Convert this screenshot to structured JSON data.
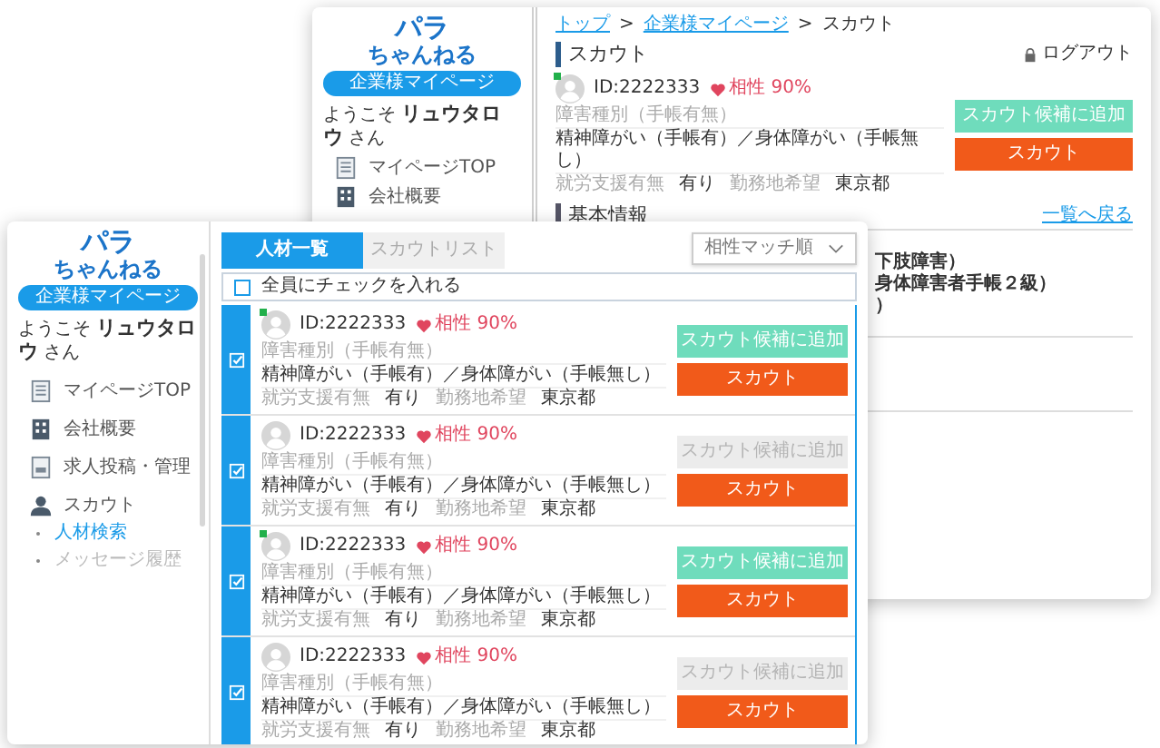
{
  "back_window": {
    "sidebar": {
      "logo": [
        "パラ",
        "ちゃんねる"
      ],
      "mypage_button": "企業様マイページ",
      "welcome": {
        "prefix": "ようこそ",
        "name": "リュウタロウ",
        "suffix": "さん"
      },
      "menu": [
        {
          "label": "マイページTOP",
          "kind": "document"
        },
        {
          "label": "会社概要",
          "kind": "building"
        }
      ]
    },
    "breadcrumb": [
      {
        "label": "トップ",
        "link": true
      },
      {
        "separator": ">",
        "label": "企業様マイページ",
        "link": true
      },
      {
        "separator": ">",
        "label": "スカウト",
        "link": false
      }
    ],
    "title": "スカウト",
    "logout": "ログアウト",
    "profile": {
      "online": true,
      "id": "ID:2222333",
      "match": "相性 90%",
      "disability_label": "障害種別（手帳有無）",
      "disability_value": "精神障がい（手帳有）／身体障がい（手帳無し）",
      "support_label": "就労支援有無",
      "support_value": "有り",
      "location_label": "勤務地希望",
      "location_value": "東京都",
      "add_button": "スカウト候補に追加",
      "add_enabled": true,
      "scout_button": "スカウト"
    },
    "section_title": "基本情報",
    "back_link": "一覧へ戻る",
    "partial_lines": [
      "下肢障害）",
      "身体障害者手帳２級）",
      "）"
    ]
  },
  "front_window": {
    "sidebar": {
      "logo": [
        "パラ",
        "ちゃんねる"
      ],
      "mypage_button": "企業様マイページ",
      "welcome": {
        "prefix": "ようこそ",
        "name": "リュウタロウ",
        "suffix": "さん"
      },
      "menu": [
        {
          "label": "マイページTOP",
          "kind": "document"
        },
        {
          "label": "会社概要",
          "kind": "building"
        },
        {
          "label": "求人投稿・管理",
          "kind": "form"
        },
        {
          "label": "スカウト",
          "kind": "person"
        }
      ],
      "submenu": [
        {
          "label": "人材検索",
          "selected": true
        },
        {
          "label": "メッセージ履歴",
          "selected": false
        }
      ]
    },
    "tabs": [
      {
        "label": "人材一覧",
        "selected": true
      },
      {
        "label": "スカウトリスト",
        "selected": false
      }
    ],
    "sort_select": "相性マッチ順",
    "check_all": {
      "label": "全員にチェックを入れる",
      "checked": false
    },
    "candidates": [
      {
        "checked": true,
        "online": true,
        "id": "ID:2222333",
        "match": "相性 90%",
        "disability_label": "障害種別（手帳有無）",
        "disability_value": "精神障がい（手帳有）／身体障がい（手帳無し）",
        "support_label": "就労支援有無",
        "support_value": "有り",
        "location_label": "勤務地希望",
        "location_value": "東京都",
        "add_button": "スカウト候補に追加",
        "add_enabled": true,
        "scout_button": "スカウト"
      },
      {
        "checked": true,
        "online": false,
        "id": "ID:2222333",
        "match": "相性 90%",
        "disability_label": "障害種別（手帳有無）",
        "disability_value": "精神障がい（手帳有）／身体障がい（手帳無し）",
        "support_label": "就労支援有無",
        "support_value": "有り",
        "location_label": "勤務地希望",
        "location_value": "東京都",
        "add_button": "スカウト候補に追加",
        "add_enabled": false,
        "scout_button": "スカウト"
      },
      {
        "checked": true,
        "online": true,
        "id": "ID:2222333",
        "match": "相性 90%",
        "disability_label": "障害種別（手帳有無）",
        "disability_value": "精神障がい（手帳有）／身体障がい（手帳無し）",
        "support_label": "就労支援有無",
        "support_value": "有り",
        "location_label": "勤務地希望",
        "location_value": "東京都",
        "add_button": "スカウト候補に追加",
        "add_enabled": true,
        "scout_button": "スカウト"
      },
      {
        "checked": true,
        "online": false,
        "id": "ID:2222333",
        "match": "相性 90%",
        "disability_label": "障害種別（手帳有無）",
        "disability_value": "精神障がい（手帳有）／身体障がい（手帳無し）",
        "support_label": "就労支援有無",
        "support_value": "有り",
        "location_label": "勤務地希望",
        "location_value": "東京都",
        "add_button": "スカウト候補に追加",
        "add_enabled": false,
        "scout_button": "スカウト"
      }
    ]
  }
}
